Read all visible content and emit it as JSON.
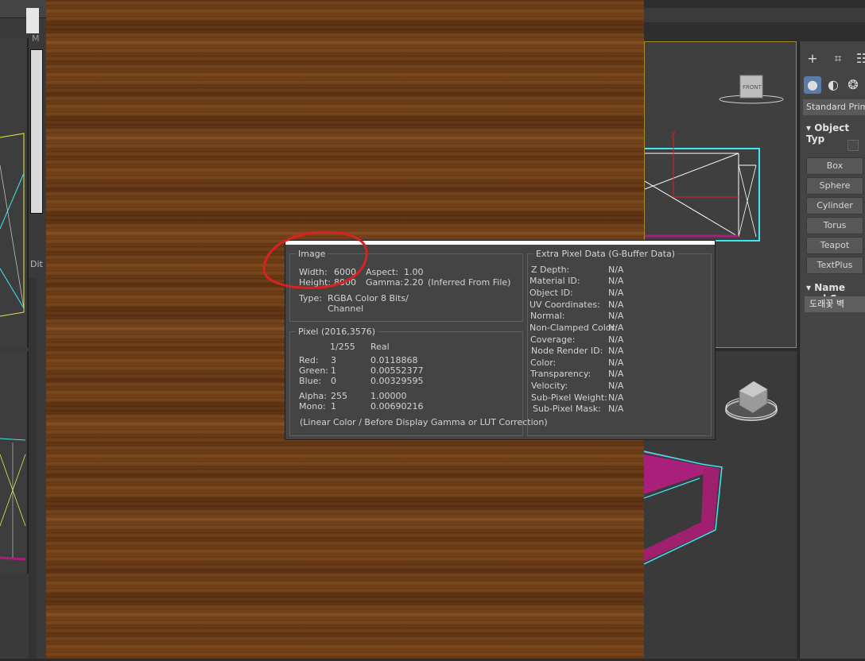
{
  "left_panel": {
    "m_label": "M",
    "d_label": "Dit"
  },
  "command_panel": {
    "dropdown": "Standard Primiti",
    "object_type_title": "Object Typ",
    "buttons": [
      "Box",
      "Sphere",
      "Cylinder",
      "Torus",
      "Teapot",
      "TextPlus"
    ],
    "name_title": "Name and C",
    "name_value": "도래꽃 벽"
  },
  "viewport": {
    "front_label": "FRONT",
    "axis_y": "y"
  },
  "info_popup": {
    "image": {
      "legend": "Image",
      "width_label": "Width:",
      "width_value": "6000",
      "height_label": "Height:",
      "height_value": "8000",
      "aspect_label": "Aspect:",
      "aspect_value": "1.00",
      "gamma_label": "Gamma:",
      "gamma_value": "2.20",
      "gamma_note": "(Inferred From File)",
      "type_label": "Type:",
      "type_value_1": "RGBA Color 8 Bits/",
      "type_value_2": "Channel"
    },
    "pixel": {
      "legend": "Pixel (2016,3576)",
      "col1": "1/255",
      "col2": "Real",
      "rows": [
        {
          "label": "Red:",
          "v255": "3",
          "real": "0.0118868"
        },
        {
          "label": "Green:",
          "v255": "1",
          "real": "0.00552377"
        },
        {
          "label": "Blue:",
          "v255": "0",
          "real": "0.00329595"
        },
        {
          "label": "Alpha:",
          "v255": "255",
          "real": "1.00000"
        },
        {
          "label": "Mono:",
          "v255": "1",
          "real": "0.00690216"
        }
      ],
      "note": "(Linear Color / Before Display Gamma or LUT Correction)"
    },
    "gbuffer": {
      "legend": "Extra Pixel Data (G-Buffer Data)",
      "rows": [
        {
          "label": "Z Depth:",
          "value": "N/A"
        },
        {
          "label": "Material ID:",
          "value": "N/A"
        },
        {
          "label": "Object ID:",
          "value": "N/A"
        },
        {
          "label": "UV Coordinates:",
          "value": "N/A"
        },
        {
          "label": "Normal:",
          "value": "N/A"
        },
        {
          "label": "Non-Clamped Color:",
          "value": "N/A"
        },
        {
          "label": "Coverage:",
          "value": "N/A"
        },
        {
          "label": "Node Render ID:",
          "value": "N/A"
        },
        {
          "label": "Color:",
          "value": "N/A"
        },
        {
          "label": "Transparency:",
          "value": "N/A"
        },
        {
          "label": "Velocity:",
          "value": "N/A"
        },
        {
          "label": "Sub-Pixel Weight:",
          "value": "N/A"
        },
        {
          "label": "Sub-Pixel Mask:",
          "value": "N/A"
        }
      ]
    }
  },
  "colors": {
    "annotation": "#d9221f",
    "wire_cyan": "#3fe6f0",
    "wire_magenta": "#a8207a",
    "viewport_active_border": "#a88b2a"
  }
}
